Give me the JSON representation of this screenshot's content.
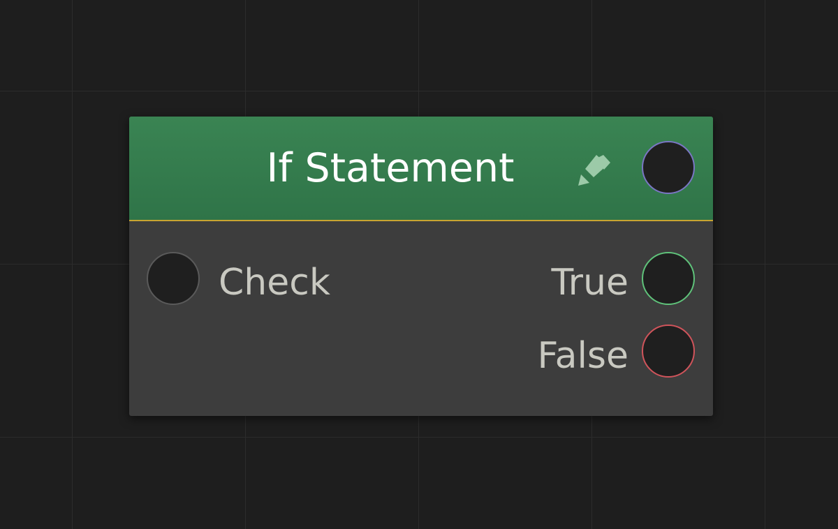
{
  "canvas": {
    "background": "#1e1e1e",
    "grid_color": "#2c2c2c"
  },
  "node": {
    "title": "If Statement",
    "header_color": "#357c4d",
    "body_color": "#3d3d3d",
    "separator_color": "#c8a531",
    "edit_icon": "pencil-icon",
    "output_socket_color": "#7a76c4",
    "inputs": [
      {
        "label": "Check",
        "socket_color": "#5a5a5a"
      }
    ],
    "outputs": [
      {
        "label": "True",
        "socket_color": "#5fc27a"
      },
      {
        "label": "False",
        "socket_color": "#d0545b"
      }
    ]
  }
}
